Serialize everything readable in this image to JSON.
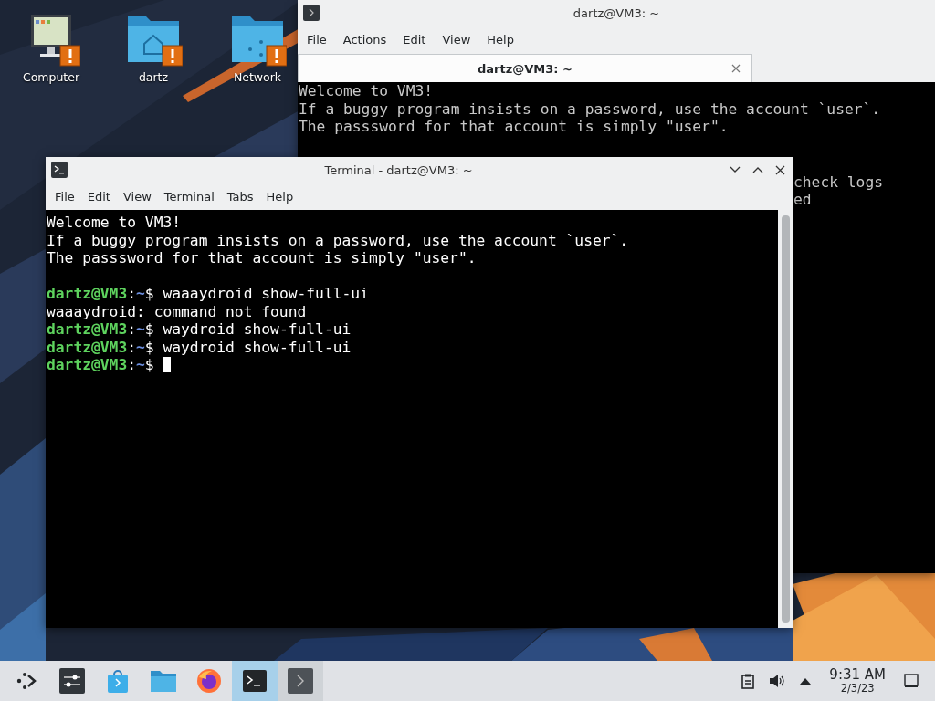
{
  "desktop_icons": [
    {
      "label": "Computer",
      "kind": "computer",
      "warning": true
    },
    {
      "label": "dartz",
      "kind": "home",
      "warning": true
    },
    {
      "label": "Network",
      "kind": "network",
      "warning": true
    }
  ],
  "back_window": {
    "title": "dartz@VM3: ~",
    "menu": [
      "File",
      "Actions",
      "Edit",
      "View",
      "Help"
    ],
    "tabs": [
      {
        "label": "dartz@VM3: ~",
        "selected": true
      }
    ],
    "lines": [
      "Welcome to VM3!",
      "If a buggy program insists on a password, use the account `user`.",
      "The passsword for that account is simply \"user\"."
    ],
    "partial_lines": [
      "check logs",
      "ed"
    ]
  },
  "front_window": {
    "title": "Terminal - dartz@VM3: ~",
    "menu": [
      "File",
      "Edit",
      "View",
      "Terminal",
      "Tabs",
      "Help"
    ],
    "lines": [
      {
        "kind": "output",
        "text": "Welcome to VM3!"
      },
      {
        "kind": "output",
        "text": "If a buggy program insists on a password, use the account `user`."
      },
      {
        "kind": "output",
        "text": "The passsword for that account is simply \"user\"."
      },
      {
        "kind": "blank"
      },
      {
        "kind": "prompt",
        "user_host": "dartz@VM3",
        "colon": ":",
        "path": "~",
        "sign": "$",
        "command": "waaaydroid show-full-ui"
      },
      {
        "kind": "output",
        "text": "waaaydroid: command not found"
      },
      {
        "kind": "prompt",
        "user_host": "dartz@VM3",
        "colon": ":",
        "path": "~",
        "sign": "$",
        "command": "waydroid show-full-ui"
      },
      {
        "kind": "prompt",
        "user_host": "dartz@VM3",
        "colon": ":",
        "path": "~",
        "sign": "$",
        "command": "waydroid show-full-ui"
      },
      {
        "kind": "prompt",
        "user_host": "dartz@VM3",
        "colon": ":",
        "path": "~",
        "sign": "$",
        "cursor": true
      }
    ]
  },
  "taskbar": {
    "items": [
      {
        "kind": "launcher",
        "selected": false,
        "open": false
      },
      {
        "kind": "settings",
        "selected": false,
        "open": false
      },
      {
        "kind": "store",
        "selected": false,
        "open": false
      },
      {
        "kind": "files",
        "selected": false,
        "open": false
      },
      {
        "kind": "browser",
        "selected": false,
        "open": false
      },
      {
        "kind": "terminal",
        "selected": true,
        "open": true
      },
      {
        "kind": "konsole",
        "selected": false,
        "open": true
      }
    ],
    "tray": [
      {
        "kind": "clipboard"
      },
      {
        "kind": "volume"
      },
      {
        "kind": "expand"
      }
    ],
    "time": "9:31 AM",
    "date": "2/3/23"
  }
}
